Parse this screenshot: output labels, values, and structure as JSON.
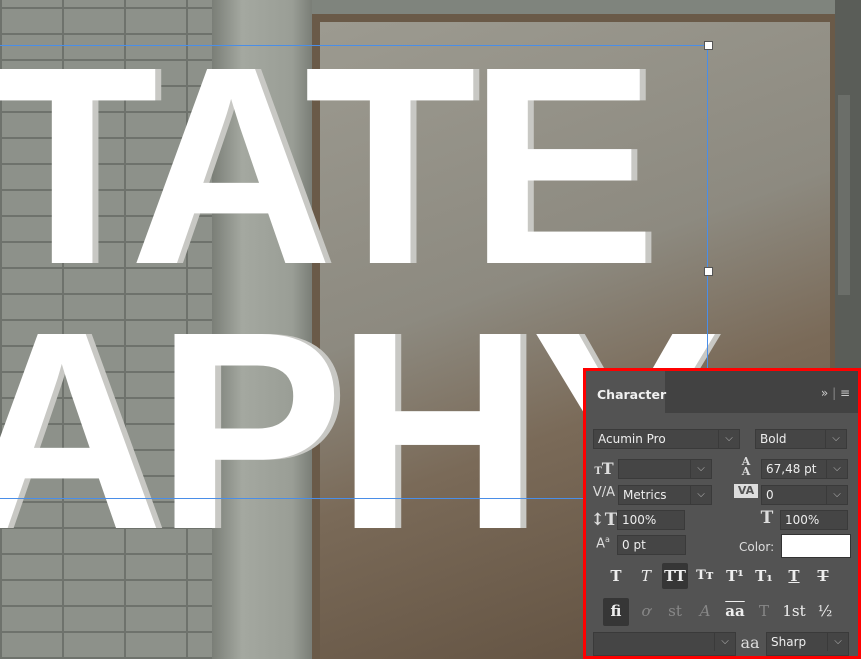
{
  "canvas": {
    "line1": "TATE",
    "line2": "APHY"
  },
  "panel": {
    "title": "Character",
    "collapse_icon": "»",
    "font_family": "Acumin Pro",
    "font_style": "Bold",
    "font_size": "",
    "leading": "67,48 pt",
    "kerning": "Metrics",
    "tracking": "0",
    "vertical_scale": "100%",
    "horizontal_scale": "100%",
    "baseline_shift": "0 pt",
    "color_label": "Color:",
    "color_value": "#ffffff",
    "style_buttons": [
      "T",
      "T",
      "TT",
      "Tт",
      "T¹",
      "T₁",
      "T",
      "T"
    ],
    "opentype_buttons": [
      "fi",
      "ơ",
      "st",
      "A",
      "aa",
      "T",
      "1st",
      "½"
    ],
    "language": "",
    "antialias_icon": "aa",
    "antialias": "Sharp"
  }
}
